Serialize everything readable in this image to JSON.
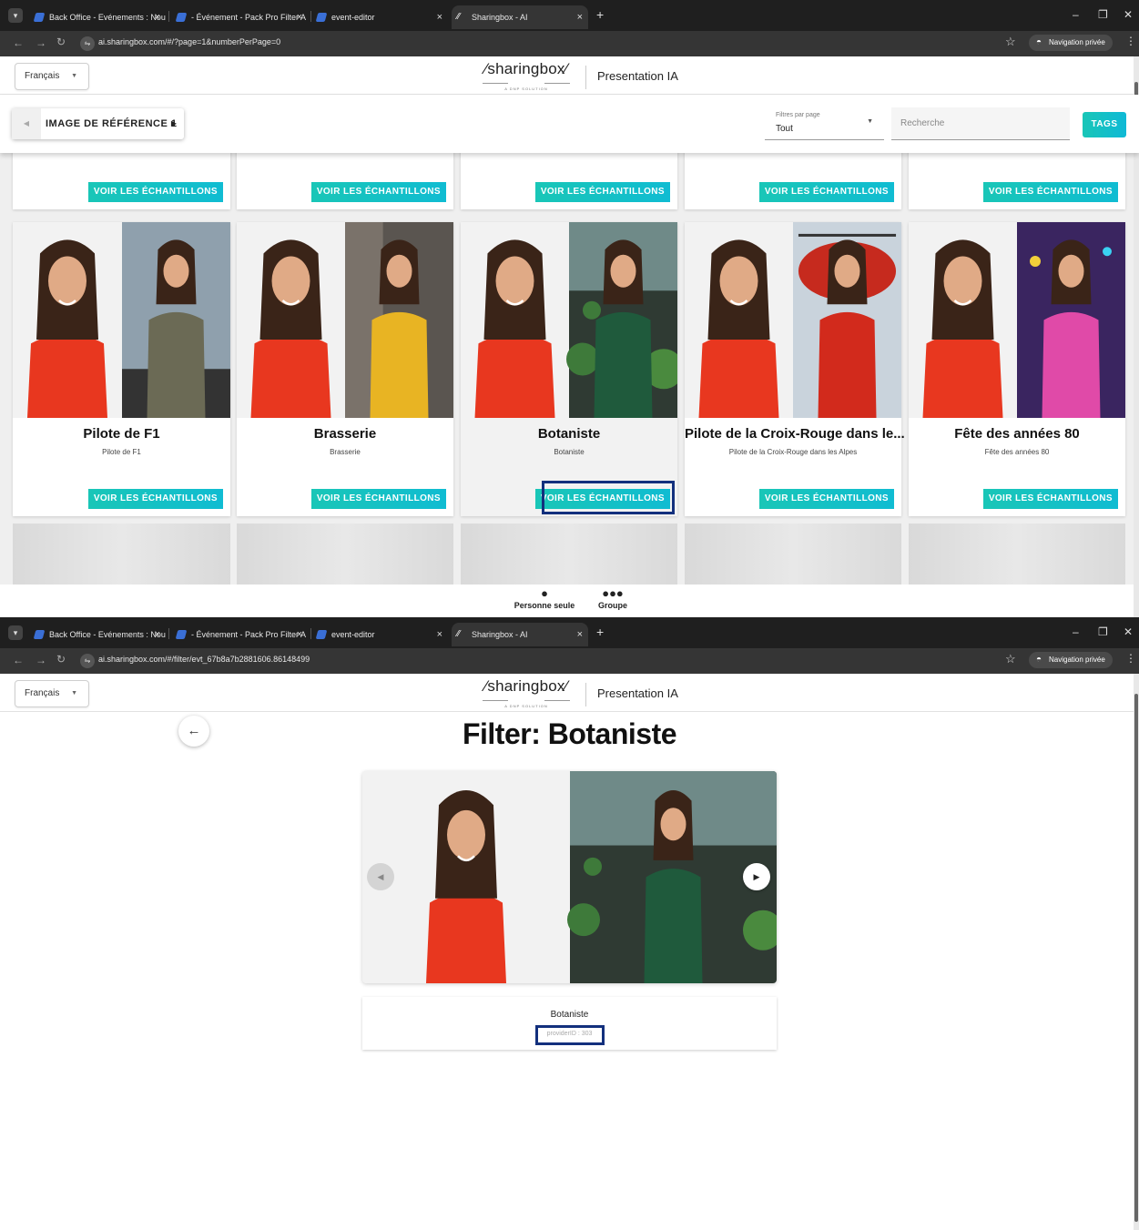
{
  "browser": {
    "tabs": [
      {
        "label": "Back Office - Evénements : Nou"
      },
      {
        "label": "- Événement - Pack Pro Filter A"
      },
      {
        "label": "event-editor"
      },
      {
        "label": "Sharingbox - AI"
      }
    ],
    "new_tab": "+",
    "close": "×",
    "private_label": "Navigation privée",
    "url_list": "ai.sharingbox.com/#/?page=1&numberPerPage=0",
    "url_detail": "ai.sharingbox.com/#/filter/evt_67b8a7b2881606.86148499"
  },
  "header": {
    "language": "Français",
    "logo_text": "⁄sharingbox⁄",
    "logo_sub": "A DNP SOLUTION",
    "title": "Presentation IA"
  },
  "toolbar": {
    "pager_label": "IMAGE DE RÉFÉRENCE 1",
    "filter_label": "Filtres par page",
    "filter_value": "Tout",
    "search_placeholder": "Recherche",
    "tags_button": "TAGS"
  },
  "sample_button": "VOIR LES ÉCHANTILLONS",
  "cards": [
    {
      "title": "Pilote de F1",
      "description": "Pilote de F1",
      "scene": "race",
      "selected": false
    },
    {
      "title": "Brasserie",
      "description": "Brasserie",
      "scene": "brasserie",
      "selected": false
    },
    {
      "title": "Botaniste",
      "description": "Botaniste",
      "scene": "plants",
      "selected": true
    },
    {
      "title": "Pilote de la Croix-Rouge dans le...",
      "description": "Pilote de la Croix-Rouge dans les Alpes",
      "scene": "heli",
      "selected": false
    },
    {
      "title": "Fête des années 80",
      "description": "Fête des années 80",
      "scene": "party80",
      "selected": false
    }
  ],
  "bottom_tabs": [
    {
      "label": "Personne seule",
      "icon": "person-icon"
    },
    {
      "label": "Groupe",
      "icon": "group-icon"
    }
  ],
  "detail": {
    "heading": "Filter: Botaniste",
    "name": "Botaniste",
    "provider": "providerID : 303"
  },
  "colors": {
    "accent_teal": "#19c6b7",
    "highlight_border": "#13307d",
    "chrome_dark": "#1f1f1f"
  }
}
